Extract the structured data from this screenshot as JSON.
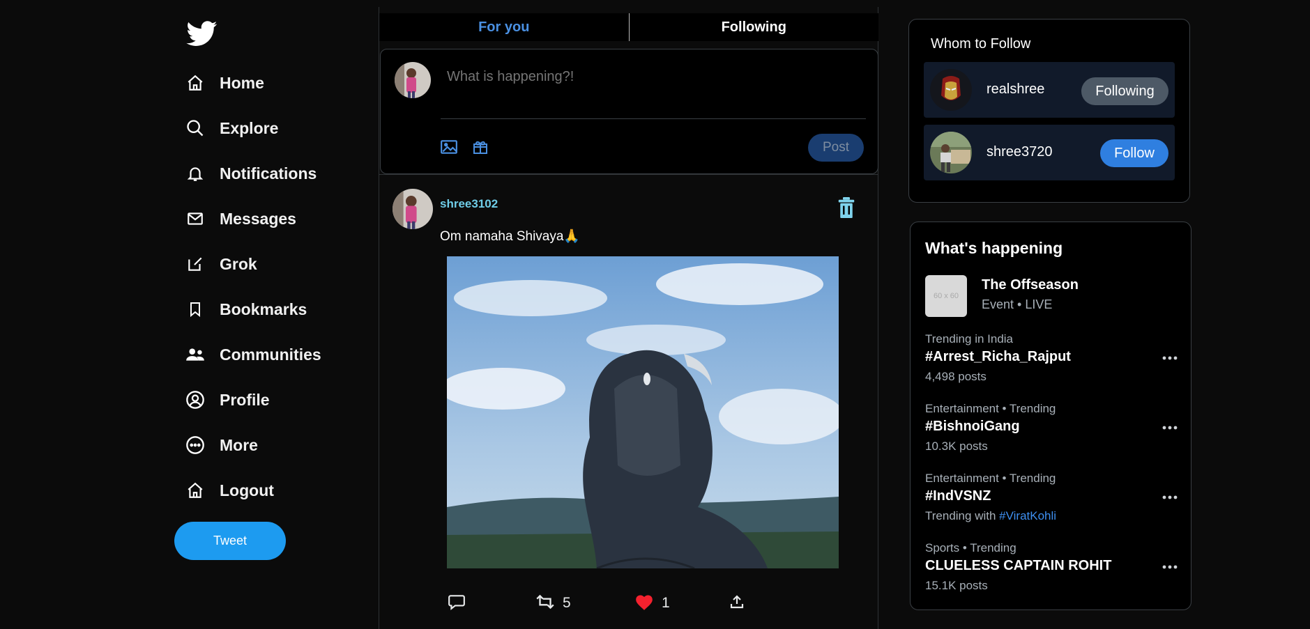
{
  "nav": {
    "items": [
      {
        "label": "Home",
        "icon": "home-icon"
      },
      {
        "label": "Explore",
        "icon": "search-icon"
      },
      {
        "label": "Notifications",
        "icon": "bell-icon"
      },
      {
        "label": "Messages",
        "icon": "mail-icon"
      },
      {
        "label": "Grok",
        "icon": "edit-square-icon"
      },
      {
        "label": "Bookmarks",
        "icon": "bookmark-icon"
      },
      {
        "label": "Communities",
        "icon": "people-icon"
      },
      {
        "label": "Profile",
        "icon": "user-circle-icon"
      },
      {
        "label": "More",
        "icon": "more-circle-icon"
      },
      {
        "label": "Logout",
        "icon": "home-icon"
      }
    ],
    "tweet_label": "Tweet"
  },
  "tabs": [
    {
      "label": "For you",
      "active": true
    },
    {
      "label": "Following",
      "active": false
    }
  ],
  "composer": {
    "placeholder": "What is happening?!",
    "post_label": "Post"
  },
  "post": {
    "username": "shree3102",
    "text": "Om namaha Shivaya🙏",
    "replies": "",
    "retweets": "5",
    "likes": "1"
  },
  "follow": {
    "title": "Whom to Follow",
    "users": [
      {
        "name": "realshree",
        "button": "Following"
      },
      {
        "name": "shree3720",
        "button": "Follow"
      }
    ]
  },
  "trends": {
    "title": "What's happening",
    "event": {
      "thumb": "60 x 60",
      "title": "The Offseason",
      "sub": "Event • LIVE"
    },
    "items": [
      {
        "category": "Trending in India",
        "title": "#Arrest_Richa_Rajput",
        "count": "4,498 posts"
      },
      {
        "category": "Entertainment • Trending",
        "title": "#BishnoiGang",
        "count": "10.3K posts"
      },
      {
        "category": "Entertainment • Trending",
        "title": "#IndVSNZ",
        "count_prefix": "Trending with ",
        "count_link": "#ViratKohli"
      },
      {
        "category": "Sports • Trending",
        "title": "CLUELESS CAPTAIN ROHIT",
        "count": "15.1K posts"
      }
    ]
  },
  "colors": {
    "accent": "#1d9bf0",
    "tab_active": "#4a90e2",
    "username": "#6fcde8",
    "like": "#f4212e"
  }
}
